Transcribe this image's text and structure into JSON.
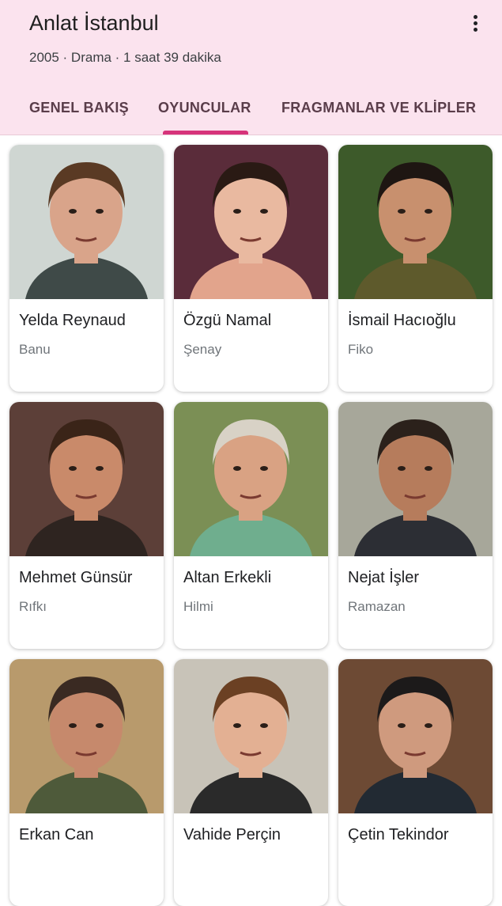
{
  "header": {
    "title": "Anlat İstanbul",
    "meta": "2005 · Drama · 1 saat 39 dakika",
    "menu_icon": "more-vert-icon",
    "background": "#fbe3ee"
  },
  "tabs": [
    {
      "label": "GENEL BAKIŞ",
      "active": false
    },
    {
      "label": "OYUNCULAR",
      "active": true
    },
    {
      "label": "FRAGMANLAR VE KLİPLER",
      "active": false
    }
  ],
  "cast": [
    {
      "name": "Yelda Reynaud",
      "role": "Banu",
      "bg": "#cfd6d2",
      "skin": "#d9a48a",
      "hair": "#5a3a24",
      "shirt": "#3f4a48"
    },
    {
      "name": "Özgü Namal",
      "role": "Şenay",
      "bg": "#5a2c3a",
      "skin": "#e9b9a0",
      "hair": "#2a1a14",
      "shirt": "#e2a48c"
    },
    {
      "name": "İsmail Hacıoğlu",
      "role": "Fiko",
      "bg": "#3d5a2a",
      "skin": "#c8906e",
      "hair": "#1e1612",
      "shirt": "#5e5a2c"
    },
    {
      "name": "Mehmet Günsür",
      "role": "Rıfkı",
      "bg": "#5c3f38",
      "skin": "#c98a6a",
      "hair": "#3a2418",
      "shirt": "#2e2420"
    },
    {
      "name": "Altan Erkekli",
      "role": "Hilmi",
      "bg": "#7b8f55",
      "skin": "#d9a283",
      "hair": "#d8d2c6",
      "shirt": "#6fae8e"
    },
    {
      "name": "Nejat İşler",
      "role": "Ramazan",
      "bg": "#a7a79a",
      "skin": "#b67c5c",
      "hair": "#2b211b",
      "shirt": "#2c2e34"
    },
    {
      "name": "Erkan Can",
      "role": "",
      "bg": "#b89a6c",
      "skin": "#c6896c",
      "hair": "#3a2a22",
      "shirt": "#4e5a3a"
    },
    {
      "name": "Vahide Perçin",
      "role": "",
      "bg": "#c8c3b8",
      "skin": "#e3b093",
      "hair": "#6b4023",
      "shirt": "#2a2a2a"
    },
    {
      "name": "Çetin Tekindor",
      "role": "",
      "bg": "#6d4a34",
      "skin": "#cf9a7e",
      "hair": "#1c1a1a",
      "shirt": "#222a33"
    }
  ]
}
